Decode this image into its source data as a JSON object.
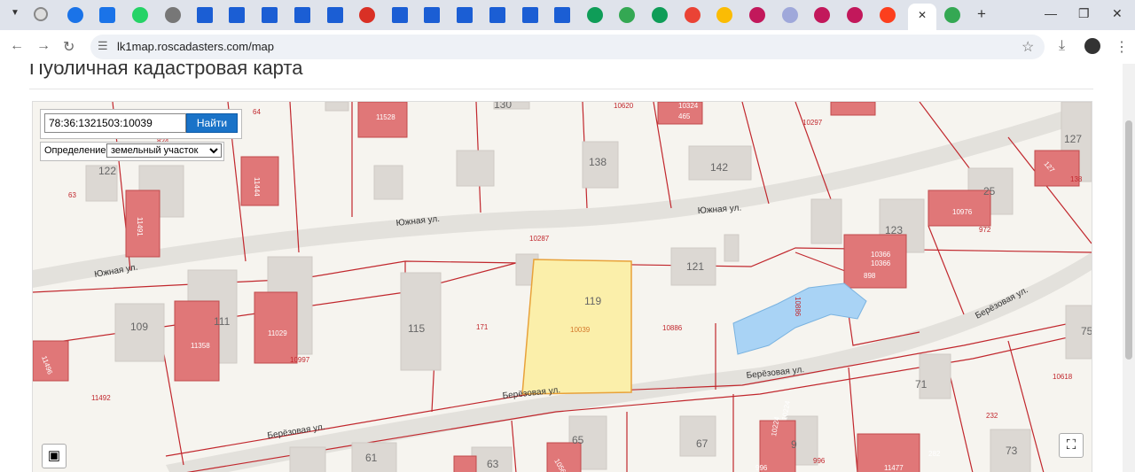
{
  "browser": {
    "url": "lk1map.roscadasters.com/map",
    "close_tab_glyph": "✕",
    "new_tab_glyph": "+"
  },
  "page": {
    "title": "Публичная кадастровая карта"
  },
  "search": {
    "value": "78:36:1321503:10039",
    "button_label": "Найти"
  },
  "definition": {
    "label": "Определение:",
    "selected": "земельный участок"
  },
  "map": {
    "streets": {
      "yuzhnaya_1": "Южная ул.",
      "yuzhnaya_2": "Южная ул.",
      "yuzhnaya_3": "Южная ул.",
      "berezovaya_1": "Берёзовая ул.",
      "berezovaya_2": "Берёзовая ул.",
      "berezovaya_3": "Берёзовая ул.",
      "berezovaya_4": "Берёзовая ул."
    },
    "labels": {
      "l64": "64",
      "l824": "824",
      "l122": "122",
      "l63": "63",
      "l11528": "11528",
      "l130": "130",
      "l10620": "10620",
      "l10324": "10324",
      "l465": "465",
      "l10297": "10297",
      "l127": "127",
      "l138": "138",
      "l142": "142",
      "l11444": "11444",
      "l11491": "11491",
      "l10287": "10287",
      "l25": "25",
      "l10976": "10976",
      "l972": "972",
      "l123": "123",
      "l10366a": "10366",
      "l10366b": "10366",
      "l898": "898",
      "l121": "121",
      "l10886a": "10886",
      "l10886b": "10886",
      "l119": "119",
      "l10039": "10039",
      "l171": "171",
      "l115": "115",
      "l109": "109",
      "l111": "111",
      "l11358": "11358",
      "l11029": "11029",
      "l10997": "10997",
      "l11496": "11496",
      "l11492": "11492",
      "l71": "71",
      "l10618": "10618",
      "l232": "232",
      "l73": "73",
      "l75": "75",
      "l65": "65",
      "l67": "67",
      "l61": "61",
      "l63b": "63",
      "l282": "282",
      "l11477": "11477",
      "l996a": "996",
      "l996b": "996",
      "l10224a": "10224",
      "l10224b": "10224",
      "l69": "9",
      "l10563": "10563",
      "l11138": "138"
    }
  },
  "controls": {
    "layers_glyph": "▣",
    "fullscreen_glyph": "⛶"
  }
}
